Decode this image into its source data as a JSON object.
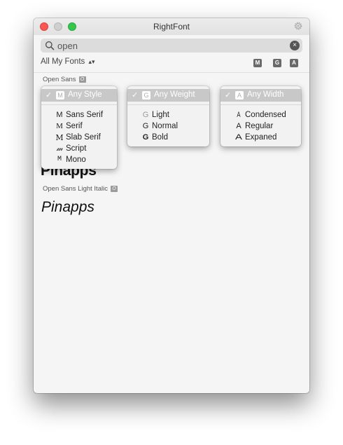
{
  "window": {
    "title": "RightFont",
    "colors": {
      "close": "#fc5753",
      "minimize": "#cfcfcf",
      "zoom": "#34c84a"
    }
  },
  "search": {
    "value": "open",
    "clear_icon": "×"
  },
  "filter": {
    "label": "All My Fonts",
    "chevron": "⌃⌄",
    "chips": [
      "M",
      "G",
      "A"
    ]
  },
  "fonts": [
    {
      "name": "Open Sans",
      "tag": "O"
    },
    {
      "name": "Open Sans Light Italic",
      "tag": "O"
    }
  ],
  "samples": {
    "bold": "Pinapps",
    "italic": "Pinapps"
  },
  "menus": {
    "style": {
      "header_icon": "M",
      "header": "Any Style",
      "items": [
        {
          "icon": "M",
          "label": "Sans Serif"
        },
        {
          "icon": "M",
          "label": "Serif"
        },
        {
          "icon": "M",
          "label": "Slab Serif"
        },
        {
          "icon": "𝓂",
          "label": "Script"
        },
        {
          "icon": "M",
          "label": "Mono"
        }
      ]
    },
    "weight": {
      "header_icon": "G",
      "header": "Any Weight",
      "items": [
        {
          "icon": "G",
          "label": "Light"
        },
        {
          "icon": "G",
          "label": "Normal"
        },
        {
          "icon": "G",
          "label": "Bold"
        }
      ]
    },
    "width": {
      "header_icon": "A",
      "header": "Any Width",
      "items": [
        {
          "icon": "A",
          "label": "Condensed"
        },
        {
          "icon": "A",
          "label": "Regular"
        },
        {
          "icon": "A",
          "label": "Expaned"
        }
      ]
    }
  }
}
